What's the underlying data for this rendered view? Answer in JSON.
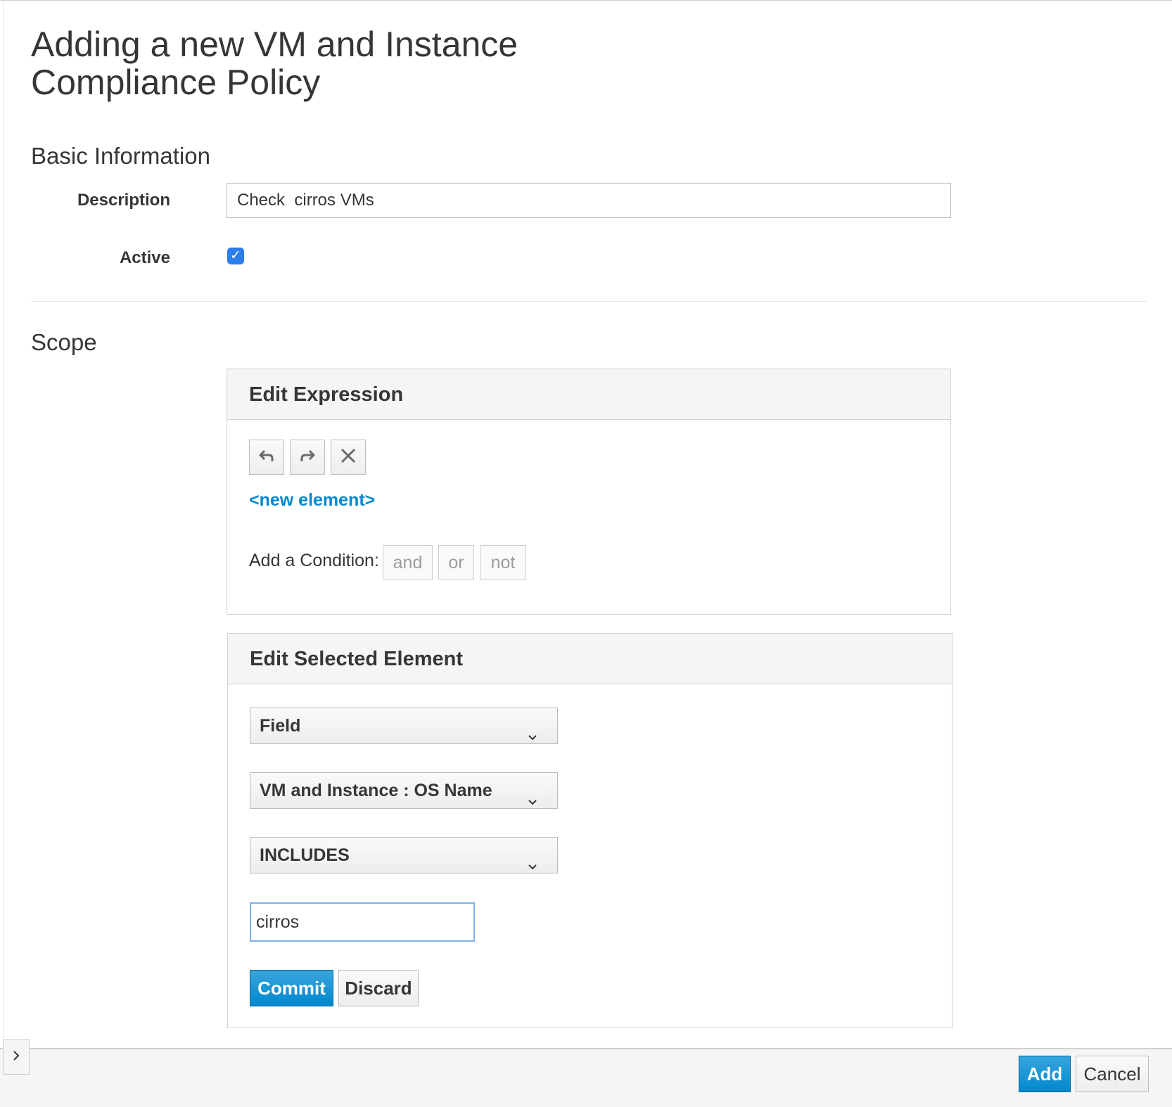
{
  "page": {
    "title": "Adding a new VM and Instance Compliance Policy"
  },
  "basic_info": {
    "heading": "Basic Information",
    "description_label": "Description",
    "description_value": "Check  cirros VMs",
    "active_label": "Active",
    "active_checked": true
  },
  "scope": {
    "heading": "Scope"
  },
  "edit_expression": {
    "heading": "Edit Expression",
    "toolbar_icons": [
      "undo-icon",
      "redo-icon",
      "close-icon"
    ],
    "new_element_link": "<new element>",
    "add_condition_label": "Add a Condition:",
    "condition_buttons": [
      "and",
      "or",
      "not"
    ]
  },
  "edit_selected": {
    "heading": "Edit Selected Element",
    "type_select": "Field",
    "field_select": "VM and Instance : OS Name",
    "operator_select": "INCLUDES",
    "value_input": "cirros",
    "commit_label": "Commit",
    "discard_label": "Discard"
  },
  "footer": {
    "add_label": "Add",
    "cancel_label": "Cancel",
    "toggle_icon": "chevron-right-icon"
  },
  "colors": {
    "primary": "#0088ce",
    "checkbox": "#2b7de9",
    "panel_heading_bg": "#f5f5f5"
  }
}
